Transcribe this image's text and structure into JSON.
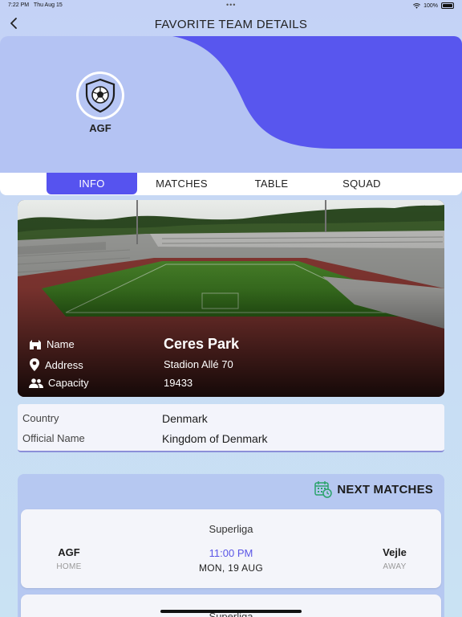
{
  "status_bar": {
    "time": "7:22 PM",
    "date": "Thu Aug 15",
    "battery": "100%"
  },
  "nav": {
    "title": "FAVORITE TEAM DETAILS"
  },
  "team": {
    "name": "AGF"
  },
  "tabs": [
    {
      "label": "INFO",
      "active": true
    },
    {
      "label": "MATCHES",
      "active": false
    },
    {
      "label": "TABLE",
      "active": false
    },
    {
      "label": "SQUAD",
      "active": false
    }
  ],
  "stadium": {
    "name_label": "Name",
    "name": "Ceres Park",
    "address_label": "Address",
    "address": "Stadion Allé 70",
    "capacity_label": "Capacity",
    "capacity": "19433"
  },
  "country": {
    "country_label": "Country",
    "country": "Denmark",
    "official_label": "Official Name",
    "official": "Kingdom of Denmark"
  },
  "next_matches": {
    "title": "NEXT MATCHES",
    "matches": [
      {
        "league": "Superliga",
        "home": "AGF",
        "home_label": "HOME",
        "time": "11:00 PM",
        "date": "MON, 19 AUG",
        "away": "Vejle",
        "away_label": "AWAY"
      },
      {
        "league": "Superliga"
      }
    ]
  },
  "colors": {
    "accent": "#5653ef",
    "hero_bg": "#b4c3f3",
    "wave": "#5856ee"
  }
}
